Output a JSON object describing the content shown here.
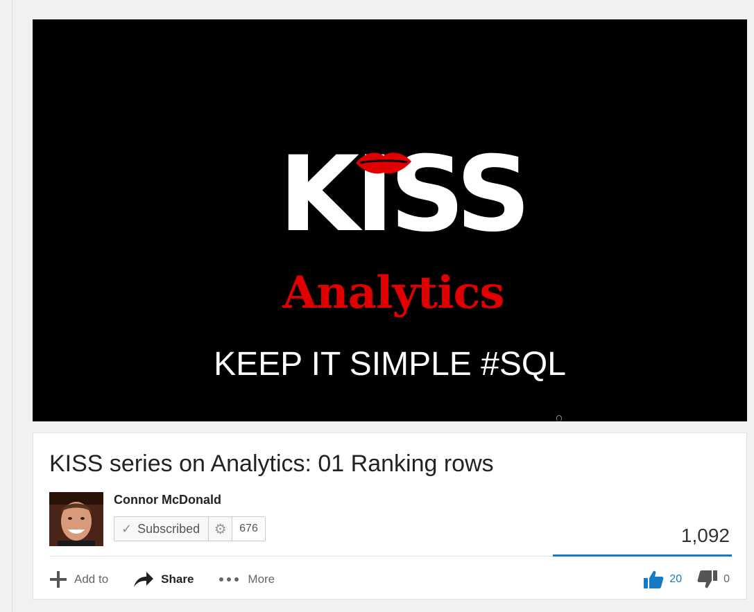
{
  "player": {
    "logo_text": "KISS",
    "logo_subtitle": "Analytics",
    "tagline": "KEEP IT SIMPLE #SQL"
  },
  "video": {
    "title": "KISS series on Analytics: 01 Ranking rows",
    "channel_name": "Connor McDonald",
    "subscribe_label": "Subscribed",
    "subscriber_count": "676",
    "view_count": "1,092"
  },
  "actions": {
    "add_to_label": "Add to",
    "share_label": "Share",
    "more_label": "More"
  },
  "ratings": {
    "likes": "20",
    "dislikes": "0",
    "like_ratio": 1.0,
    "accent_color": "#167ac6"
  },
  "icons": {
    "add": "plus-icon",
    "share": "share-arrow-icon",
    "more": "more-dots-icon",
    "like": "thumbs-up-icon",
    "dislike": "thumbs-down-icon",
    "settings": "gear-icon",
    "subscribed": "checkmark-icon",
    "logo_decoration": "lips-icon"
  }
}
